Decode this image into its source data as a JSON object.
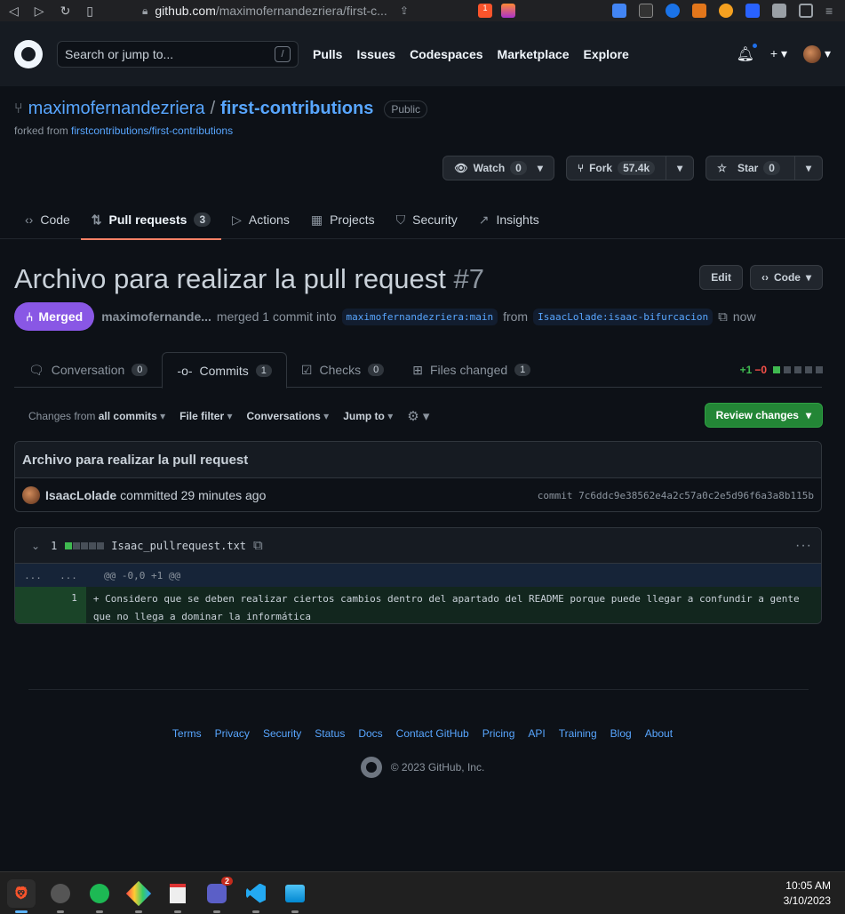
{
  "browser": {
    "url_host": "github.com",
    "url_path": "/maximofernandezriera/first-c...",
    "brave_badge": "1"
  },
  "header": {
    "search_placeholder": "Search or jump to...",
    "slash": "/",
    "nav": [
      "Pulls",
      "Issues",
      "Codespaces",
      "Marketplace",
      "Explore"
    ]
  },
  "repo": {
    "owner": "maximofernandezriera",
    "sep": "/",
    "name": "first-contributions",
    "visibility": "Public",
    "forked_prefix": "forked from ",
    "forked_from": "firstcontributions/first-contributions",
    "watch_label": "Watch",
    "watch_count": "0",
    "fork_label": "Fork",
    "fork_count": "57.4k",
    "star_label": "Star",
    "star_count": "0",
    "tabs": [
      {
        "label": "Code",
        "icon": "code-icon"
      },
      {
        "label": "Pull requests",
        "count": "3",
        "icon": "pull-request-icon"
      },
      {
        "label": "Actions",
        "icon": "play-icon"
      },
      {
        "label": "Projects",
        "icon": "table-icon"
      },
      {
        "label": "Security",
        "icon": "shield-icon"
      },
      {
        "label": "Insights",
        "icon": "graph-icon"
      }
    ]
  },
  "pr": {
    "title": "Archivo para realizar la pull request",
    "number": "#7",
    "edit_label": "Edit",
    "code_label": "Code",
    "state": "Merged",
    "author": "maximofernande...",
    "action_text": "merged 1 commit into",
    "base_branch": "maximofernandezriera:main",
    "from_text": "from",
    "head_branch": "IsaacLolade:isaac-bifurcacion",
    "time": "now",
    "tabs": [
      {
        "label": "Conversation",
        "count": "0"
      },
      {
        "label": "Commits",
        "count": "1"
      },
      {
        "label": "Checks",
        "count": "0"
      },
      {
        "label": "Files changed",
        "count": "1"
      }
    ],
    "diffstat_add": "+1",
    "diffstat_del": "−0"
  },
  "toolbar": {
    "changes_prefix": "Changes from",
    "changes_value": "all commits",
    "file_filter": "File filter",
    "conversations": "Conversations",
    "jump_to": "Jump to",
    "review_label": "Review changes"
  },
  "commit": {
    "title": "Archivo para realizar la pull request",
    "user": "IsaacLolade",
    "text": "committed 29 minutes ago",
    "sha_label": "commit 7c6ddc9e38562e4a2c57a0c2e5d96f6a3a8b115b"
  },
  "diff": {
    "count": "1",
    "filename": "Isaac_pullrequest.txt",
    "hunk_left": "...",
    "hunk_right": "...",
    "hunk_header": "@@ -0,0 +1 @@",
    "line_number": "1",
    "line_text": "+ Considero que se deben realizar ciertos cambios dentro del apartado del README porque puede llegar a confundir a gente que no llega a dominar la informática"
  },
  "footer": {
    "links": [
      "Terms",
      "Privacy",
      "Security",
      "Status",
      "Docs",
      "Contact GitHub",
      "Pricing",
      "API",
      "Training",
      "Blog",
      "About"
    ],
    "copyright": "© 2023 GitHub, Inc."
  },
  "taskbar": {
    "teams_badge": "2",
    "time": "10:05 AM",
    "date": "3/10/2023"
  }
}
